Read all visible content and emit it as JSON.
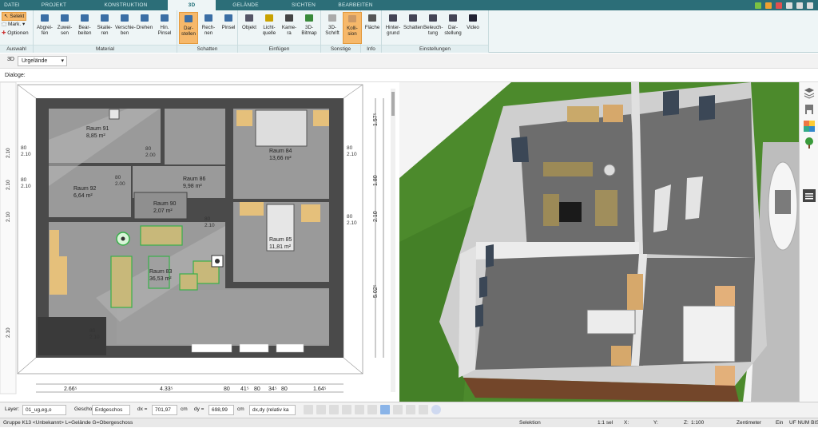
{
  "tabs": [
    "DATEI",
    "PROJEKT",
    "KONSTRUKTION",
    "3D",
    "GELÄNDE",
    "SICHTEN",
    "BEARBEITEN"
  ],
  "active_tab": "3D",
  "ribbon": {
    "selection": {
      "select": "Selekt",
      "mark": "Mark.",
      "options": "Optionen",
      "title": "Auswahl"
    },
    "material": {
      "title": "Material",
      "buttons": [
        {
          "l1": "Abgrei-",
          "l2": "fen"
        },
        {
          "l1": "Zuwei-",
          "l2": "sen"
        },
        {
          "l1": "Bear-",
          "l2": "beiten"
        },
        {
          "l1": "Skalie-",
          "l2": "ren"
        },
        {
          "l1": "Verschie-",
          "l2": "ben"
        },
        {
          "l1": "Drehen",
          "l2": ""
        },
        {
          "l1": "Hin.",
          "l2": "Pinsel"
        }
      ]
    },
    "schatten": {
      "title": "Schatten",
      "buttons": [
        {
          "l1": "Dar-",
          "l2": "stellen"
        },
        {
          "l1": "Rech-",
          "l2": "nen"
        },
        {
          "l1": "Pinsel",
          "l2": ""
        }
      ]
    },
    "einfuegen": {
      "title": "Einfügen",
      "buttons": [
        {
          "l1": "Objekt",
          "l2": ""
        },
        {
          "l1": "Licht-",
          "l2": "quelle"
        },
        {
          "l1": "Kame-",
          "l2": "ra"
        },
        {
          "l1": "3D-",
          "l2": "Bitmap"
        }
      ]
    },
    "sonstige": {
      "title": "Sonstige",
      "buttons": [
        {
          "l1": "3D-",
          "l2": "Schrift"
        },
        {
          "l1": "Kolli-",
          "l2": "sion"
        }
      ]
    },
    "info": {
      "title": "Info",
      "buttons": [
        {
          "l1": "Fläche",
          "l2": ""
        }
      ]
    },
    "einstellungen": {
      "title": "Einstellungen",
      "buttons": [
        {
          "l1": "Hinter-",
          "l2": "grund"
        },
        {
          "l1": "Schatten",
          "l2": ""
        },
        {
          "l1": "Beleuch-",
          "l2": "tung"
        },
        {
          "l1": "Dar-",
          "l2": "stellung"
        },
        {
          "l1": "Video",
          "l2": ""
        }
      ]
    }
  },
  "viewbar": {
    "mode": "3D",
    "terrain": "Urgelände"
  },
  "dialoge_label": "Dialoge:",
  "rooms": [
    {
      "name": "Raum 91",
      "area": "8,85 m²"
    },
    {
      "name": "Raum 92",
      "area": "6,64 m²"
    },
    {
      "name": "Raum 86",
      "area": "9,98 m²"
    },
    {
      "name": "Raum 90",
      "area": "2,07 m²"
    },
    {
      "name": "Raum 84",
      "area": "13,66 m²"
    },
    {
      "name": "Raum 85",
      "area": "11,81 m²"
    },
    {
      "name": "Raum 83",
      "area": "36,53 m²"
    }
  ],
  "dims_bottom": [
    "2.66⁵",
    "4.33⁵",
    "80",
    "41⁵",
    "80",
    "34⁵",
    "80",
    "1.64⁵"
  ],
  "dims_right": [
    "1.57⁵",
    "1.80",
    "2.10",
    "5.02⁵"
  ],
  "status": {
    "layer_label": "Layer:",
    "layer_value": "01_ug,eg,o",
    "geschoss_label": "Geschoss:",
    "geschoss_value": "Erdgeschos",
    "dx_label": "dx =",
    "dx_value": "701,97",
    "dy_label": "dy =",
    "dy_value": "698,99",
    "unit": "cm",
    "relative": "dx,dy (relativ ka"
  },
  "footer": {
    "group": "Gruppe K13 <Unbekannt> L=Gelände G=Obergeschoss",
    "mode": "Selektion",
    "scale1": "1:1 sel",
    "x": "X:",
    "y": "Y:",
    "z": "Z:",
    "scale2": "1:100",
    "unit": "Zentimeter",
    "ein": "Ein",
    "flags": "UF NUM BIS"
  },
  "colors": {
    "accent": "#2c6e78",
    "active_button": "#f6b86a",
    "grass": "#4c8a2c"
  }
}
